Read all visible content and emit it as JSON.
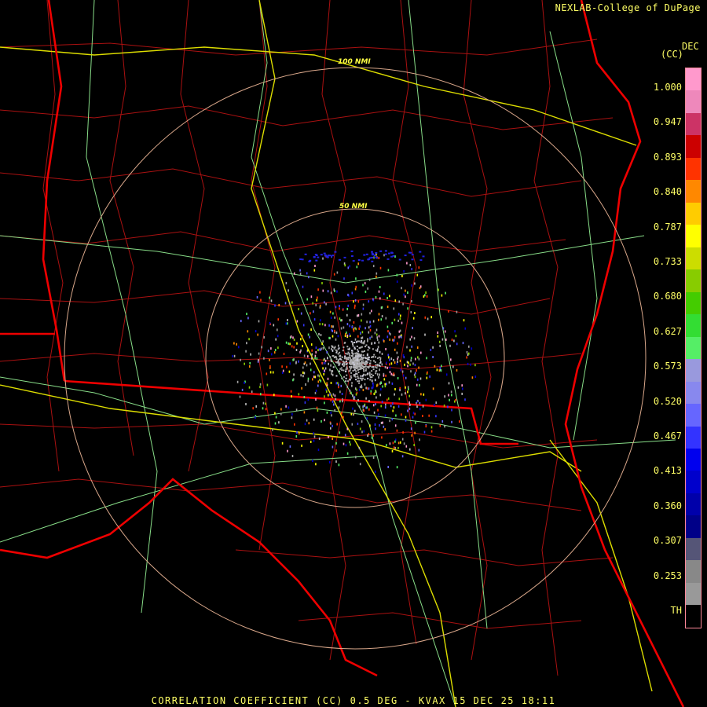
{
  "header": {
    "credit": "NEXLAB-College of DuPage",
    "unit_top": "DEC",
    "unit_bottom": "(CC)"
  },
  "rings": [
    {
      "label": "100 NMI"
    },
    {
      "label": "50 NMI"
    }
  ],
  "legend": {
    "ticks": [
      "1.000",
      "0.947",
      "0.893",
      "0.840",
      "0.787",
      "0.733",
      "0.680",
      "0.627",
      "0.573",
      "0.520",
      "0.467",
      "0.413",
      "0.360",
      "0.307",
      "0.253",
      "TH"
    ],
    "colors": [
      "#ff99cc",
      "#ee88bb",
      "#cc3366",
      "#cc0000",
      "#ff3300",
      "#ff8800",
      "#ffcc00",
      "#ffff00",
      "#ccdd00",
      "#88cc00",
      "#44cc00",
      "#33dd33",
      "#55ee66",
      "#9999dd",
      "#8888ee",
      "#6666ff",
      "#3333ff",
      "#0000ee",
      "#0000cc",
      "#0000aa",
      "#000088",
      "#555577",
      "#888888",
      "#999999",
      "#000000"
    ]
  },
  "footer": {
    "caption": "CORRELATION COEFFICIENT (CC) 0.5 DEG - KVAX 15 DEC 25 18:11"
  }
}
